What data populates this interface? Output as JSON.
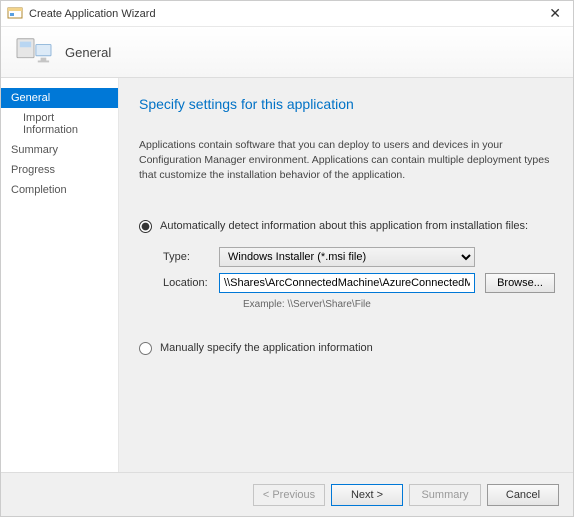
{
  "window": {
    "title": "Create Application Wizard"
  },
  "header": {
    "title": "General"
  },
  "sidebar": {
    "items": [
      {
        "label": "General",
        "active": true
      },
      {
        "label": "Import Information",
        "sub": true
      },
      {
        "label": "Summary"
      },
      {
        "label": "Progress"
      },
      {
        "label": "Completion"
      }
    ]
  },
  "content": {
    "heading": "Specify settings for this application",
    "description": "Applications contain software that you can deploy to users and devices in your Configuration Manager environment. Applications can contain multiple deployment types that customize the installation behavior of the application.",
    "option_auto": "Automatically detect information about this application from installation files:",
    "option_manual": "Manually specify the application information",
    "type_label": "Type:",
    "type_value": "Windows Installer (*.msi file)",
    "location_label": "Location:",
    "location_value": "\\\\Shares\\ArcConnectedMachine\\AzureConnectedMachineAgent.msi",
    "example_label": "Example: \\\\Server\\Share\\File",
    "browse_label": "Browse..."
  },
  "footer": {
    "previous": "< Previous",
    "next": "Next >",
    "summary": "Summary",
    "cancel": "Cancel"
  }
}
